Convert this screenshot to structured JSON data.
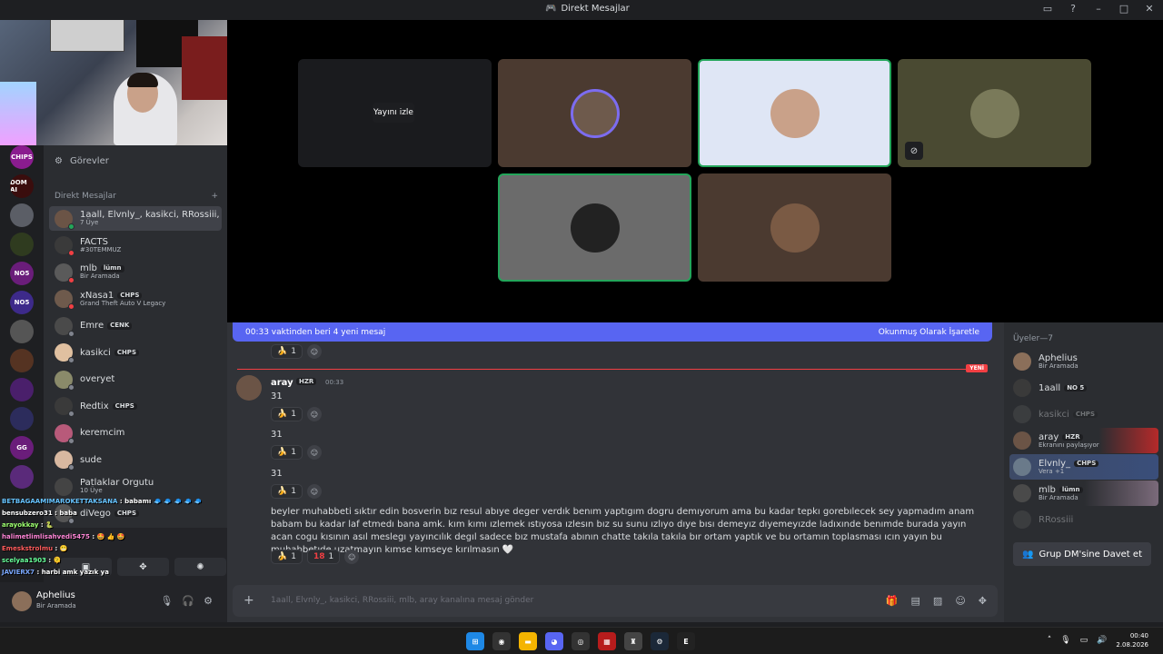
{
  "window": {
    "title": "Direkt Mesajlar"
  },
  "sidebar": {
    "tasks_label": "Görevler",
    "dm_header": "Direkt Mesajlar",
    "dm_add": "+",
    "dms": [
      {
        "name": "1aall, Elvnly_, kasikci, RRossiii, ...",
        "sub": "7 Üye",
        "tag": ""
      },
      {
        "name": "FACTS",
        "sub": "#30TEMMUZ",
        "tag": ""
      },
      {
        "name": "mlb",
        "sub": "Bir Aramada",
        "tag": "lümn"
      },
      {
        "name": "xNasa1",
        "sub": "Grand Theft Auto V Legacy",
        "tag": "CHPS"
      },
      {
        "name": "Emre",
        "sub": "",
        "tag": "CENK"
      },
      {
        "name": "kasikci",
        "sub": "",
        "tag": "CHPS"
      },
      {
        "name": "overyet",
        "sub": "",
        "tag": ""
      },
      {
        "name": "Redtix",
        "sub": "",
        "tag": "CHPS"
      },
      {
        "name": "keremcim",
        "sub": "",
        "tag": ""
      },
      {
        "name": "sude",
        "sub": "",
        "tag": ""
      },
      {
        "name": "Patlaklar Orgutu",
        "sub": "10 Üye",
        "tag": ""
      },
      {
        "name": "diVego",
        "sub": "",
        "tag": "CHPS"
      }
    ],
    "servers": [
      {
        "label": "CHIPS",
        "color": "#8a1c8f"
      },
      {
        "label": "DOM AI",
        "color": "#3a0d0d"
      },
      {
        "label": "",
        "color": "#5b5e66"
      },
      {
        "label": "",
        "color": "#2f3b1f"
      },
      {
        "label": "NO5",
        "color": "#6a1d7a"
      },
      {
        "label": "NO5",
        "color": "#3d2a8a"
      },
      {
        "label": "",
        "color": "#555"
      },
      {
        "label": "",
        "color": "#553322"
      },
      {
        "label": "",
        "color": "#4a1f6b"
      },
      {
        "label": "",
        "color": "#2c2c5c"
      },
      {
        "label": "GG",
        "color": "#6a1d7a"
      },
      {
        "label": "",
        "color": "#5a2a7a"
      }
    ]
  },
  "user_panel": {
    "name": "Aphelius",
    "status": "Bir Aramada"
  },
  "stage": {
    "watch_label": "Yayını izle"
  },
  "chat": {
    "new_banner": "00:33 vaktinden beri 4 yeni mesaj",
    "mark_read": "Okunmuş Olarak İşaretle",
    "new_tag": "YENİ",
    "author": "aray",
    "author_tag": "HZR",
    "time": "00:33",
    "lines": [
      "31",
      "31",
      "31"
    ],
    "long_message": "beyler muhabbeti sıktır edin bosverin bız resul abıye deger verdık benım yaptıgım dogru demıyorum ama bu kadar tepkı gorebılecek sey yapmadım anam babam bu kadar laf etmedı bana amk. kım kımı ızlemek ıstıyosa ızlesın bız su sunu ızlıyo dıye bısı demeyız dıyemeyızde ladıxınde benımde burada yayın acan cogu kısının asıl meslegı yayıncılık degıl sadece bız mustafa abının chatte takıla takıla bır ortam yaptık ve bu ortamın toplasması ıcın yayın bu muhabbetıde uzatmayın kımse kımseye kırılmasın 🤍",
    "reaction_count": "1",
    "reaction_18": "1",
    "composer_placeholder": "1aall, Elvnly_, kasikci, RRossiii, mlb, aray kanalına mesaj gönder"
  },
  "members": {
    "header": "Üyeler—7",
    "list": [
      {
        "name": "Aphelius",
        "sub": "Bir Aramada",
        "tag": "",
        "dim": false
      },
      {
        "name": "1aall",
        "sub": "",
        "tag": "NO 5",
        "dim": false
      },
      {
        "name": "kasikci",
        "sub": "",
        "tag": "CHPS",
        "dim": true
      },
      {
        "name": "aray",
        "sub": "Ekranını paylaşıyor",
        "tag": "HZR",
        "dim": false
      },
      {
        "name": "Elvnly_",
        "sub": "Vera +1",
        "tag": "CHPS",
        "dim": false
      },
      {
        "name": "mlb",
        "sub": "Bir Aramada",
        "tag": "lümn",
        "dim": false
      },
      {
        "name": "RRossiii",
        "sub": "",
        "tag": "",
        "dim": true
      }
    ],
    "invite_label": "Grup DM'sine Davet et"
  },
  "overlay_chat": [
    {
      "user": "BETBAGAAMIMAROKETTAKSANA",
      "text": ": babamı 🧢 🧢 🧢 🧢 🧢",
      "color": "#66c3ff"
    },
    {
      "user": "bensubzero31",
      "text": ": baba",
      "color": "#ffffff"
    },
    {
      "user": "arayokkay",
      "text": ": 🐍",
      "color": "#9cff6e"
    },
    {
      "user": "halimetlimlisahvedi5475",
      "text": ": 🤩 👍 🤩",
      "color": "#ff85d6"
    },
    {
      "user": "Emeskstrolmu",
      "text": ": 😬",
      "color": "#ff5b5b"
    },
    {
      "user": "scelyaa1903",
      "text": ": 🫠",
      "color": "#66ff99"
    },
    {
      "user": "JAVIERX7",
      "text": ": harbi amk yazık ya",
      "color": "#7aa8ff"
    }
  ],
  "taskbar": {
    "time": "00:40",
    "date": "2.08.2026"
  },
  "colors": {
    "accent": "#5865f2",
    "online": "#23a55a",
    "dnd": "#f23f43",
    "idle": "#f0b232"
  }
}
